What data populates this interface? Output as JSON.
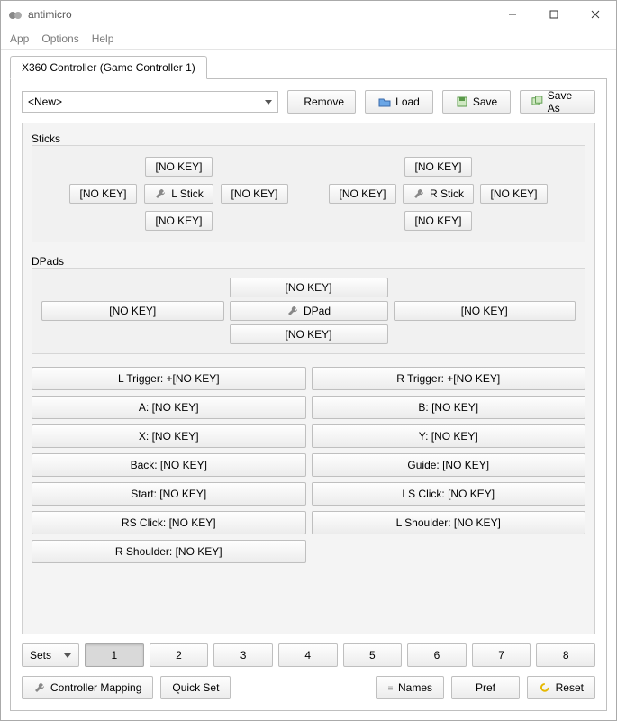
{
  "window": {
    "title": "antimicro"
  },
  "menu": {
    "app": "App",
    "options": "Options",
    "help": "Help"
  },
  "tab": {
    "label": "X360 Controller (Game Controller 1)"
  },
  "profile": {
    "selected": "<New>"
  },
  "toolbar": {
    "remove": "Remove",
    "load": "Load",
    "save": "Save",
    "saveas": "Save As"
  },
  "sticks": {
    "label": "Sticks",
    "left": {
      "up": "[NO KEY]",
      "left": "[NO KEY]",
      "center": "L Stick",
      "right": "[NO KEY]",
      "down": "[NO KEY]"
    },
    "right": {
      "up": "[NO KEY]",
      "left": "[NO KEY]",
      "center": "R Stick",
      "right": "[NO KEY]",
      "down": "[NO KEY]"
    }
  },
  "dpads": {
    "label": "DPads",
    "up": "[NO KEY]",
    "left": "[NO KEY]",
    "center": "DPad",
    "right": "[NO KEY]",
    "down": "[NO KEY]"
  },
  "buttons": {
    "ltrigger": "L Trigger: +[NO KEY]",
    "rtrigger": "R Trigger: +[NO KEY]",
    "a": "A: [NO KEY]",
    "b": "B: [NO KEY]",
    "x": "X: [NO KEY]",
    "y": "Y: [NO KEY]",
    "back": "Back: [NO KEY]",
    "guide": "Guide: [NO KEY]",
    "start": "Start: [NO KEY]",
    "lsclick": "LS Click: [NO KEY]",
    "rsclick": "RS Click: [NO KEY]",
    "lshoulder": "L Shoulder: [NO KEY]",
    "rshoulder": "R Shoulder: [NO KEY]"
  },
  "sets": {
    "label": "Sets",
    "values": [
      "1",
      "2",
      "3",
      "4",
      "5",
      "6",
      "7",
      "8"
    ],
    "active": 0
  },
  "footer": {
    "mapping": "Controller Mapping",
    "quickset": "Quick Set",
    "names": "Names",
    "pref": "Pref",
    "reset": "Reset"
  }
}
